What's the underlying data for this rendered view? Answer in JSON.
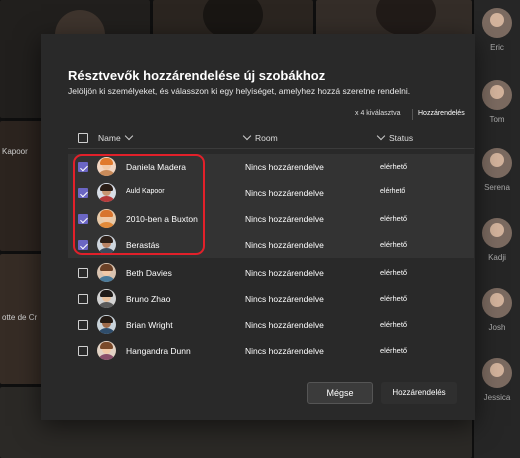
{
  "stage": {
    "left_label": "otte de Cr",
    "left_label_upper": "Kapoor"
  },
  "roster": [
    {
      "name": "Eric"
    },
    {
      "name": "Tom"
    },
    {
      "name": "Serena"
    },
    {
      "name": "Kadji"
    },
    {
      "name": "Josh"
    },
    {
      "name": "Jessica"
    }
  ],
  "dialog": {
    "title": "Résztvevők hozzárendelése új szobákhoz",
    "subtitle": "Jelöljön ki személyeket, és válasszon ki egy helyiséget, amelyhez hozzá szeretne rendelni.",
    "selection_info": "x 4 kiválasztva",
    "assign_top_label": "Hozzárendelés",
    "columns": {
      "name": "Name",
      "room": "Room",
      "status": "Status"
    },
    "rows": [
      {
        "name": "Daniela Madera",
        "room": "Nincs hozzárendelve",
        "status": "elérhető",
        "checked": true
      },
      {
        "name": "Auld Kapoor",
        "room": "Nincs hozzárendelve",
        "status": "elérhető",
        "checked": true
      },
      {
        "name": "2010-ben a Buxton",
        "room": "Nincs hozzárendelve",
        "status": "elérhető",
        "checked": true
      },
      {
        "name": "Berastás",
        "room": "Nincs hozzárendelve",
        "status": "elérhető",
        "checked": true
      },
      {
        "name": "Beth Davies",
        "room": "Nincs hozzárendelve",
        "status": "elérhető",
        "checked": false
      },
      {
        "name": "Bruno Zhao",
        "room": "Nincs hozzárendelve",
        "status": "elérhető",
        "checked": false
      },
      {
        "name": "Brian Wright",
        "room": "Nincs hozzárendelve",
        "status": "elérhető",
        "checked": false
      },
      {
        "name": "Hangandra Dunn",
        "room": "Nincs hozzárendelve",
        "status": "elérhető",
        "checked": false
      }
    ],
    "cancel_label": "Mégse",
    "assign_label": "Hozzárendelés"
  },
  "colors": {
    "checkbox_checked": "#6b66c4",
    "highlight": "#e2202a",
    "dialog_bg": "#292929"
  }
}
